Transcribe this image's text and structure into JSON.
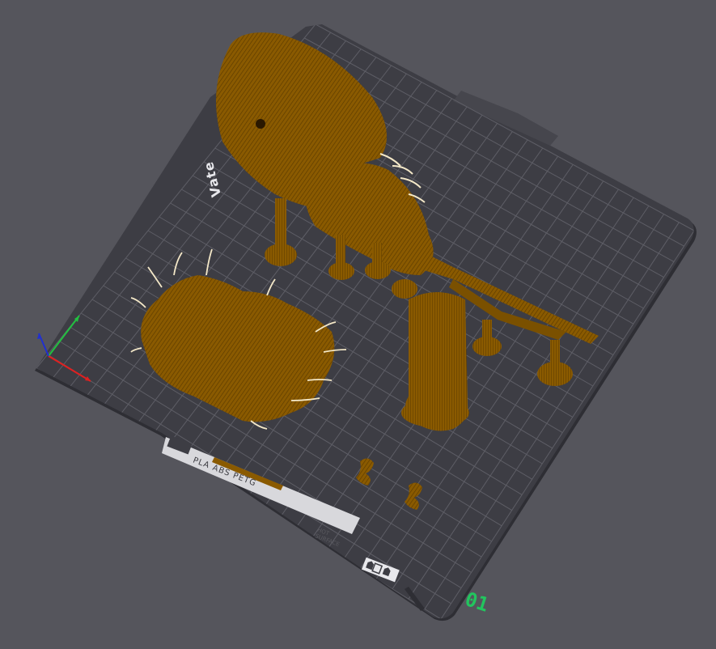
{
  "viewport": {
    "background": "#55555c",
    "plate_number": "01",
    "plate_number_color": "#22c55e"
  },
  "bed": {
    "brand_text": "Vate",
    "material_text": "PLA ABS PETG",
    "surface_text_line1": "HOT",
    "surface_text_line2": "SURFACE",
    "color": "#3d3d44",
    "grid_color": "#5e5e66"
  },
  "model": {
    "color": "#8a5a00"
  },
  "axes": {
    "x_color": "#e02020",
    "y_color": "#22c040",
    "z_color": "#2030d0"
  }
}
